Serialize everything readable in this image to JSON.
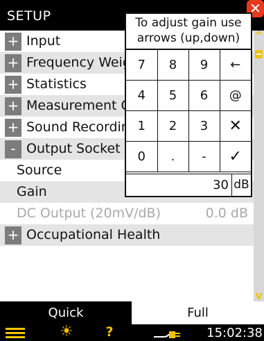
{
  "header": {
    "title": "SETUP",
    "close_glyph": "✕"
  },
  "setup": {
    "rows": [
      {
        "toggle": "+",
        "label": "Input"
      },
      {
        "toggle": "+",
        "label": "Frequency Weig"
      },
      {
        "toggle": "+",
        "label": "Statistics"
      },
      {
        "toggle": "+",
        "label": "Measurement C"
      },
      {
        "toggle": "+",
        "label": "Sound Recordin"
      },
      {
        "toggle": "-",
        "label": "Output Socket S"
      },
      {
        "label": "Source"
      },
      {
        "label": "Gain"
      },
      {
        "label": "DC Output (20mV/dB)",
        "value": "0.0 dB"
      },
      {
        "toggle": "+",
        "label": "Occupational Health"
      }
    ]
  },
  "keypad": {
    "hint_line1": "To adjust gain use",
    "hint_line2": "arrows (up,down)",
    "keys": [
      [
        "7",
        "8",
        "9",
        "←"
      ],
      [
        "4",
        "5",
        "6",
        "@"
      ],
      [
        "1",
        "2",
        "3",
        "✕"
      ],
      [
        "0",
        ".",
        "-",
        "✓"
      ]
    ],
    "value": "30",
    "unit": "dB"
  },
  "scrollbar": {
    "up_glyph": "^",
    "down_glyph": "v"
  },
  "tabs": {
    "quick": "Quick",
    "full": "Full",
    "active": "Full"
  },
  "status": {
    "time": "15:02:38",
    "icons": [
      "menu-icon",
      "backlight-sun-icon",
      "help-icon",
      "power-plug-icon"
    ],
    "accent_color": "#f2c400"
  }
}
